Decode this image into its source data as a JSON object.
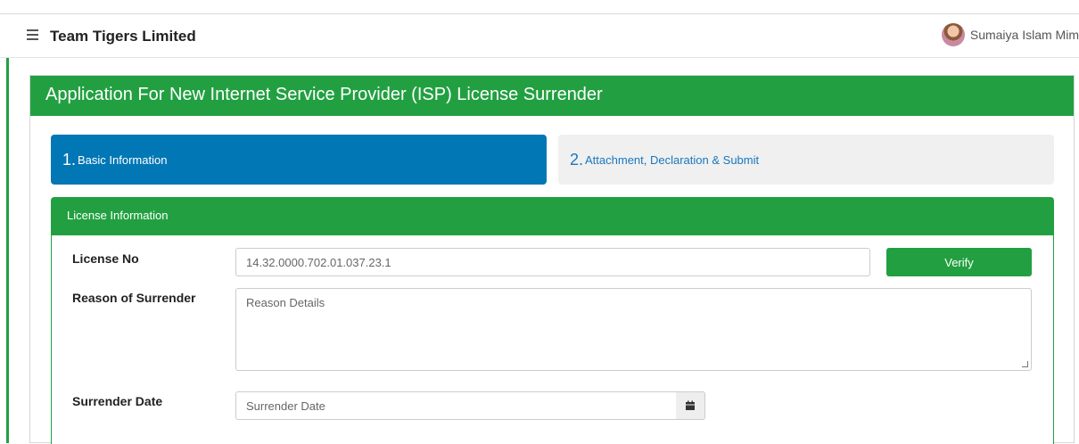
{
  "header": {
    "brand": "Team Tigers Limited",
    "user_name": "Sumaiya Islam Mim"
  },
  "page": {
    "title": "Application For New Internet Service Provider (ISP) License Surrender"
  },
  "steps": [
    {
      "number": "1.",
      "label": "Basic Information",
      "active": true
    },
    {
      "number": "2.",
      "label": "Attachment, Declaration & Submit",
      "active": false
    }
  ],
  "license_card": {
    "title": "License Information",
    "license_no_label": "License No",
    "license_no_value": "14.32.0000.702.01.037.23.1",
    "verify_label": "Verify",
    "reason_label": "Reason of Surrender",
    "reason_placeholder": "Reason Details",
    "date_label": "Surrender Date",
    "date_placeholder": "Surrender Date"
  },
  "colors": {
    "primary_green": "#22a041",
    "step_active_blue": "#0277b6",
    "step_inactive_bg": "#f0f0f0",
    "link_blue": "#1a77bd"
  },
  "icons": {
    "menu": "hamburger-icon",
    "calendar": "calendar-icon"
  }
}
